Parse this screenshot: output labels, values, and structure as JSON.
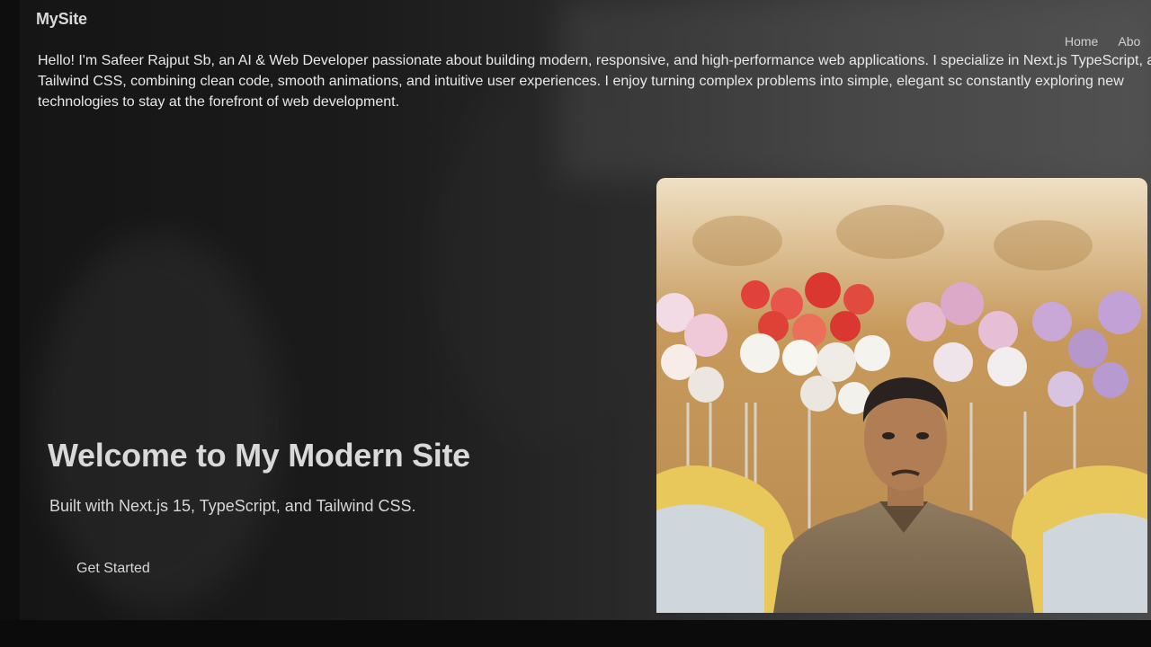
{
  "header": {
    "brand": "MySite",
    "nav": [
      "Home",
      "Abo"
    ]
  },
  "intro": {
    "text": "Hello! I'm Safeer Rajput Sb, an AI & Web Developer passionate about building modern, responsive, and high-performance web applications. I specialize in Next.js TypeScript, and Tailwind CSS, combining clean code, smooth animations, and intuitive user experiences. I enjoy turning complex problems into simple, elegant sc constantly exploring new technologies to stay at the forefront of web development."
  },
  "hero": {
    "title": "Welcome to My Modern Site",
    "subtitle": "Built with Next.js 15, TypeScript, and Tailwind CSS.",
    "cta": "Get Started"
  },
  "colors": {
    "text": "#e8e8e8",
    "background": "#151515"
  }
}
